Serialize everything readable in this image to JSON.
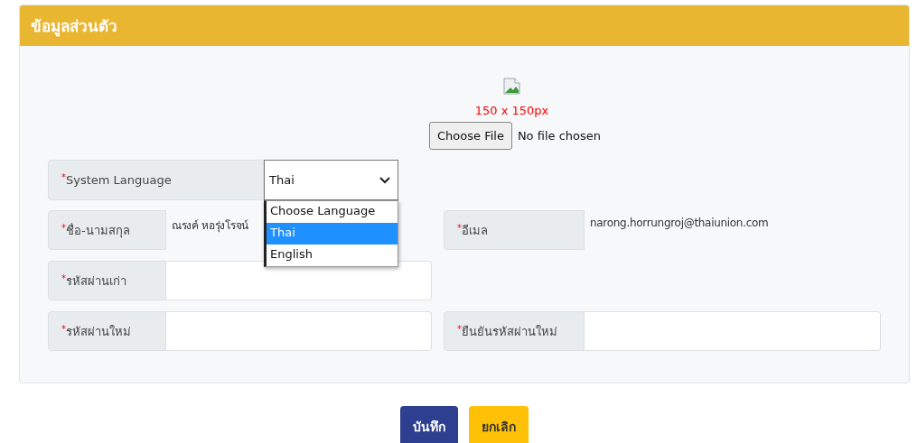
{
  "panel": {
    "title": "ข้อมูลส่วนตัว"
  },
  "photo": {
    "size_hint": "150 x 150px",
    "choose_button": "Choose File",
    "file_status": "No file chosen"
  },
  "language": {
    "mark": "*",
    "label": "System Language",
    "value": "Thai",
    "expanded": true,
    "options": [
      {
        "label": "Choose Language",
        "selected": false
      },
      {
        "label": "Thai",
        "selected": true
      },
      {
        "label": "English",
        "selected": false
      }
    ]
  },
  "rows": [
    {
      "cells": [
        {
          "kind": "text",
          "mark": "*",
          "label": "ชื่อ-นามสกุล",
          "value": "ณรงค์ หอรุ่งโรจน์"
        },
        {
          "kind": "text",
          "mark": "*",
          "label": "อีเมล",
          "value": "narong.horrungroj@thaiunion.com"
        }
      ]
    },
    {
      "cells": [
        {
          "kind": "input",
          "mark": "*",
          "label": "รหัสผ่านเก่า"
        }
      ]
    },
    {
      "cells": [
        {
          "kind": "input",
          "mark": "*",
          "label": "รหัสผ่านใหม่"
        },
        {
          "kind": "input",
          "mark": "*",
          "label": "ยืนยันรหัสผ่านใหม่"
        }
      ]
    }
  ],
  "buttons": [
    {
      "kind": "primary",
      "label": "บันทึก"
    },
    {
      "kind": "warning",
      "label": "ยกเลิก"
    }
  ]
}
